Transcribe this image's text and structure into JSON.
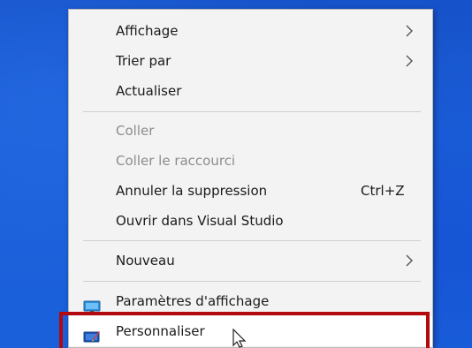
{
  "context_menu": {
    "items": [
      {
        "label": "Affichage",
        "submenu": true
      },
      {
        "label": "Trier par",
        "submenu": true
      },
      {
        "label": "Actualiser"
      },
      {
        "label": "Coller",
        "disabled": true
      },
      {
        "label": "Coller le raccourci",
        "disabled": true
      },
      {
        "label": "Annuler la suppression",
        "shortcut": "Ctrl+Z"
      },
      {
        "label": "Ouvrir dans Visual Studio"
      },
      {
        "label": "Nouveau",
        "submenu": true
      },
      {
        "label": "Paramètres d'affichage",
        "icon": "display-settings-icon"
      },
      {
        "label": "Personnaliser",
        "icon": "personalize-icon",
        "highlighted": true
      }
    ]
  },
  "colors": {
    "desktop": "#1a5ad6",
    "menu_bg": "#f3f3f3",
    "highlight_border": "#b3080d",
    "disabled_text": "#8d8d8d"
  }
}
